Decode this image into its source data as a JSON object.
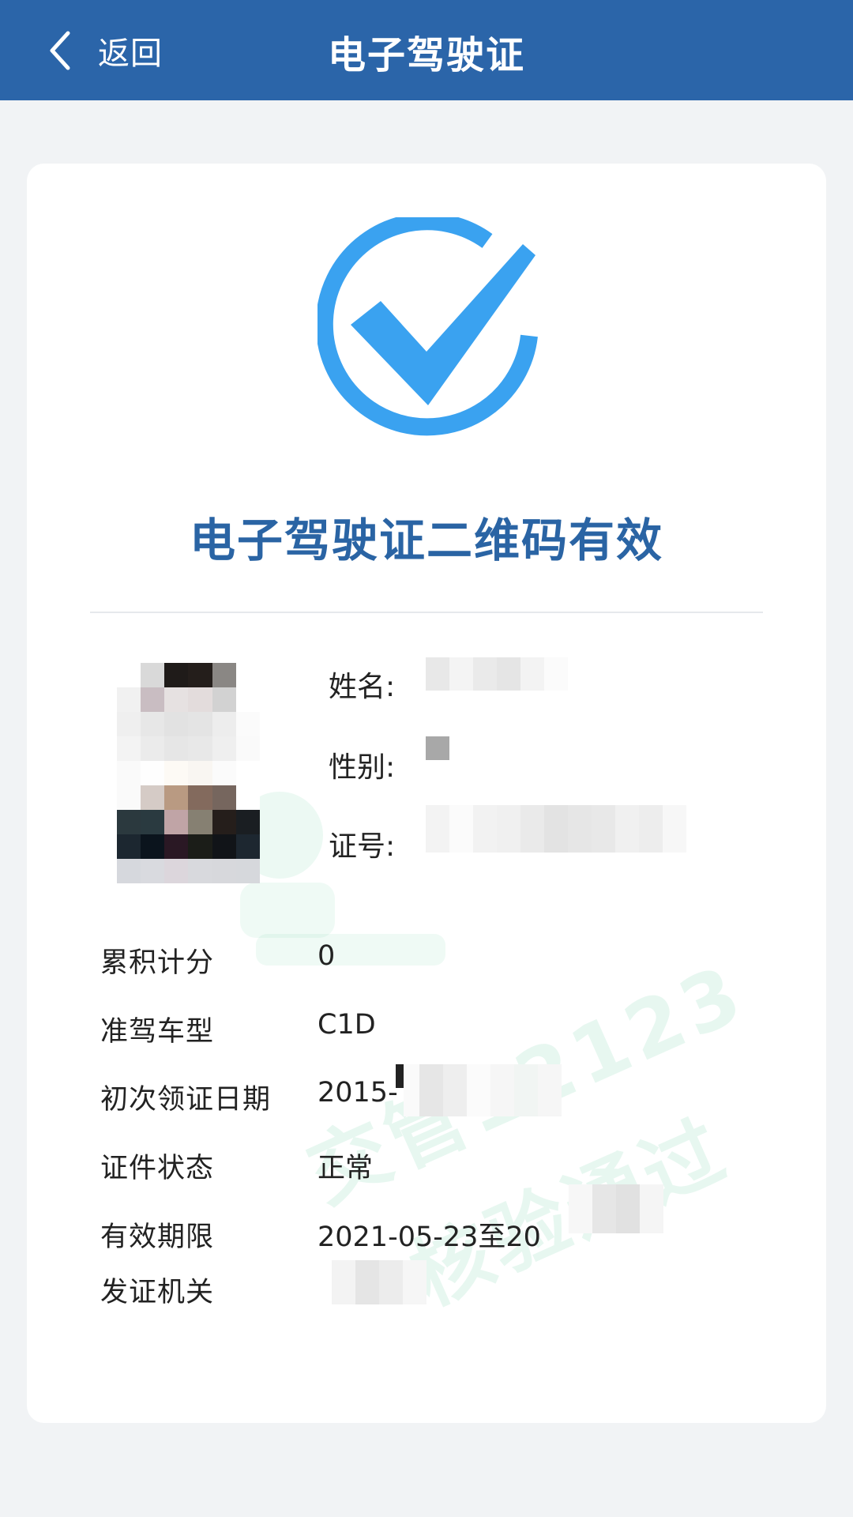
{
  "header": {
    "back_label": "返回",
    "title": "电子驾驶证"
  },
  "status": {
    "title": "电子驾驶证二维码有效",
    "icon": "check-circle-icon",
    "accent_color": "#3aa2f0"
  },
  "identity": {
    "name_label": "姓名:",
    "gender_label": "性别:",
    "id_label": "证号:"
  },
  "details": {
    "points_label": "累积计分",
    "points_value": "0",
    "class_label": "准驾车型",
    "class_value": "C1D",
    "first_issue_label": "初次领证日期",
    "first_issue_value": "2015-",
    "status_label": "证件状态",
    "status_value": "正常",
    "validity_label": "有效期限",
    "validity_value": "2021-05-23至20",
    "authority_label": "发证机关"
  },
  "watermark": {
    "line1": "交管12123",
    "line2": "核验通过"
  }
}
